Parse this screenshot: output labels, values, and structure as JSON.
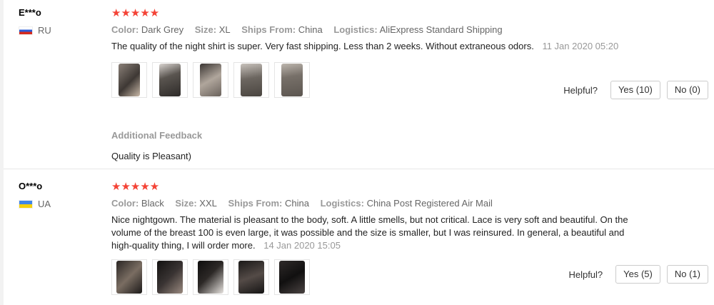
{
  "reviews": [
    {
      "user": "E***o",
      "country": "RU",
      "stars": "★★★★★",
      "color_label": "Color:",
      "color_value": "Dark Grey",
      "size_label": "Size:",
      "size_value": "XL",
      "ships_label": "Ships From:",
      "ships_value": "China",
      "logistics_label": "Logistics:",
      "logistics_value": "AliExpress Standard Shipping",
      "text": "The quality of the night shirt is super. Very fast shipping. Less than 2 weeks. Without extraneous odors.",
      "date": "11 Jan 2020 05:20",
      "helpful_label": "Helpful?",
      "yes_label": "Yes (10)",
      "no_label": "No (0)",
      "additional_title": "Additional Feedback",
      "additional_text": "Quality is Pleasant)"
    },
    {
      "user": "O***o",
      "country": "UA",
      "stars": "★★★★★",
      "color_label": "Color:",
      "color_value": "Black",
      "size_label": "Size:",
      "size_value": "XXL",
      "ships_label": "Ships From:",
      "ships_value": "China",
      "logistics_label": "Logistics:",
      "logistics_value": "China Post Registered Air Mail",
      "text": "Nice nightgown. The material is pleasant to the body, soft. A little smells, but not critical. Lace is very soft and beautiful. On the volume of the breast 100 is even large, it was possible and the size is smaller, but I was reinsured. In general, a beautiful and high-quality thing, I will order more.",
      "date": "14 Jan 2020 15:05",
      "helpful_label": "Helpful?",
      "yes_label": "Yes (5)",
      "no_label": "No (1)"
    }
  ]
}
